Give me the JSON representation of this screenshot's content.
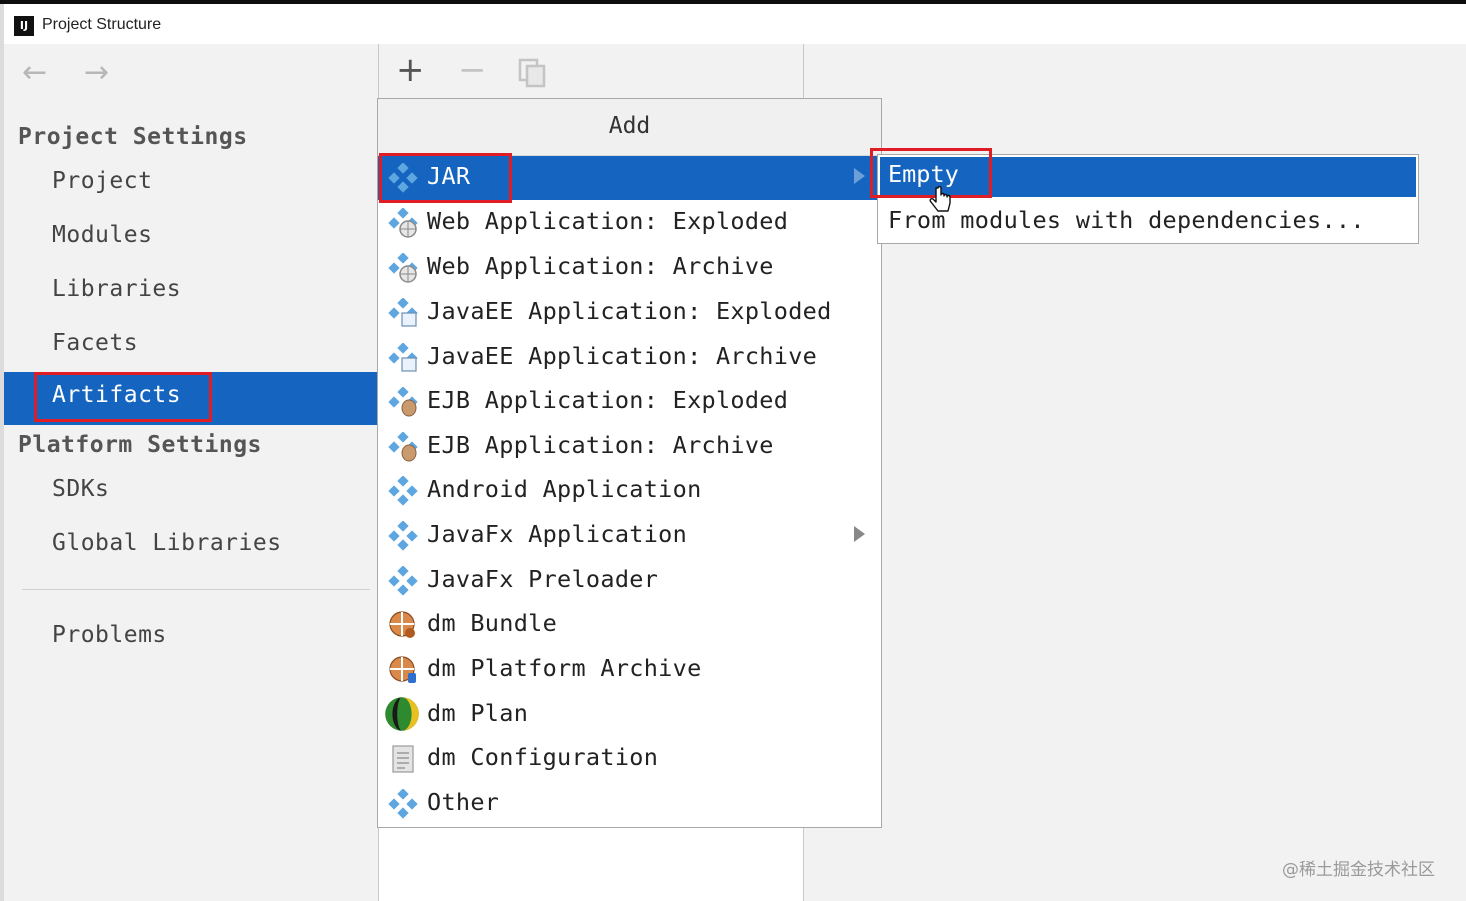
{
  "window": {
    "title": "Project Structure",
    "app_icon_text": "IJ"
  },
  "navigation": {
    "back_icon": "arrow-left-icon",
    "forward_icon": "arrow-right-icon"
  },
  "sidebar": {
    "project_settings": {
      "header": "Project Settings",
      "items": [
        {
          "label": "Project"
        },
        {
          "label": "Modules"
        },
        {
          "label": "Libraries"
        },
        {
          "label": "Facets"
        },
        {
          "label": "Artifacts",
          "selected": true
        }
      ]
    },
    "platform_settings": {
      "header": "Platform Settings",
      "items": [
        {
          "label": "SDKs"
        },
        {
          "label": "Global Libraries"
        }
      ]
    },
    "problems": {
      "label": "Problems"
    }
  },
  "toolbar": {
    "add_icon": "plus-icon",
    "remove_icon": "minus-icon",
    "copy_icon": "copy-icon"
  },
  "add_menu": {
    "title": "Add",
    "items": [
      {
        "label": "JAR",
        "icon": "artifact-icon",
        "selected": true,
        "has_submenu": true
      },
      {
        "label": "Web Application: Exploded",
        "icon": "web-artifact-icon"
      },
      {
        "label": "Web Application: Archive",
        "icon": "web-artifact-icon"
      },
      {
        "label": "JavaEE Application: Exploded",
        "icon": "javaee-artifact-icon"
      },
      {
        "label": "JavaEE Application: Archive",
        "icon": "javaee-artifact-icon"
      },
      {
        "label": "EJB Application: Exploded",
        "icon": "ejb-artifact-icon"
      },
      {
        "label": "EJB Application: Archive",
        "icon": "ejb-artifact-icon"
      },
      {
        "label": "Android Application",
        "icon": "artifact-icon"
      },
      {
        "label": "JavaFx Application",
        "icon": "artifact-icon",
        "has_submenu": true
      },
      {
        "label": "JavaFx Preloader",
        "icon": "artifact-icon"
      },
      {
        "label": "dm Bundle",
        "icon": "dm-bundle-icon"
      },
      {
        "label": "dm Platform Archive",
        "icon": "dm-platform-icon"
      },
      {
        "label": "dm Plan",
        "icon": "dm-plan-icon"
      },
      {
        "label": "dm Configuration",
        "icon": "dm-config-icon"
      },
      {
        "label": "Other",
        "icon": "artifact-icon"
      }
    ]
  },
  "jar_submenu": {
    "items": [
      {
        "label": "Empty",
        "selected": true
      },
      {
        "label": "From modules with dependencies..."
      }
    ]
  },
  "colors": {
    "selection": "#1565c0",
    "highlight_box": "#e01c24",
    "panel_bg": "#f2f2f2"
  },
  "watermark": "@稀土掘金技术社区"
}
